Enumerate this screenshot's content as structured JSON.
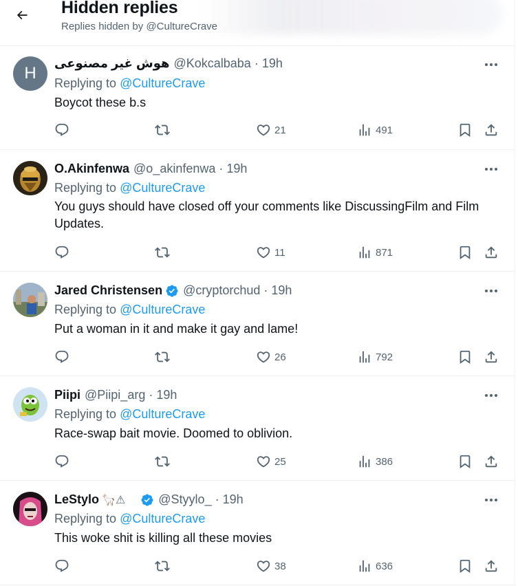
{
  "header": {
    "title": "Hidden replies",
    "subtitle": "Replies hidden by @CultureCrave"
  },
  "replying_prefix": "Replying to ",
  "tweets": [
    {
      "avatar_letter": "H",
      "name": "هوش غیر مصنوعی",
      "handle": "@Kokcalbaba",
      "dot": "·",
      "time": "19h",
      "replying_to": "@CultureCrave",
      "text": "Boycot these b.s",
      "likes": "21",
      "views": "491",
      "verified": false
    },
    {
      "name": "O.Akinfenwa",
      "handle": "@o_akinfenwa",
      "dot": "·",
      "time": "19h",
      "replying_to": "@CultureCrave",
      "text": "You guys should have closed off your comments like DiscussingFilm and Film Updates.",
      "likes": "11",
      "views": "871",
      "verified": false
    },
    {
      "name": "Jared Christensen",
      "handle": "@cryptorchud",
      "dot": "·",
      "time": "19h",
      "replying_to": "@CultureCrave",
      "text": "Put a woman in it and make it gay and lame!",
      "likes": "26",
      "views": "792",
      "verified": true
    },
    {
      "name": "Piipi",
      "handle": "@Piipi_arg",
      "dot": "·",
      "time": "19h",
      "replying_to": "@CultureCrave",
      "text": "Race-swap bait movie. Doomed to oblivion.",
      "likes": "25",
      "views": "386",
      "verified": false
    },
    {
      "name": "LeStylo",
      "name_extra": "🦙⚠",
      "handle": "@Styylo_",
      "dot": "·",
      "time": "19h",
      "replying_to": "@CultureCrave",
      "text": "This woke shit is killing all these movies",
      "likes": "38",
      "views": "636",
      "verified": true
    }
  ],
  "colors": {
    "accent": "#1d9bf0",
    "text": "#0f1419",
    "secondary": "#536471",
    "border": "#eff3f4"
  },
  "icons": [
    "back-arrow-icon",
    "more-icon",
    "reply-icon",
    "retweet-icon",
    "like-icon",
    "views-icon",
    "bookmark-icon",
    "share-icon",
    "verified-icon"
  ]
}
